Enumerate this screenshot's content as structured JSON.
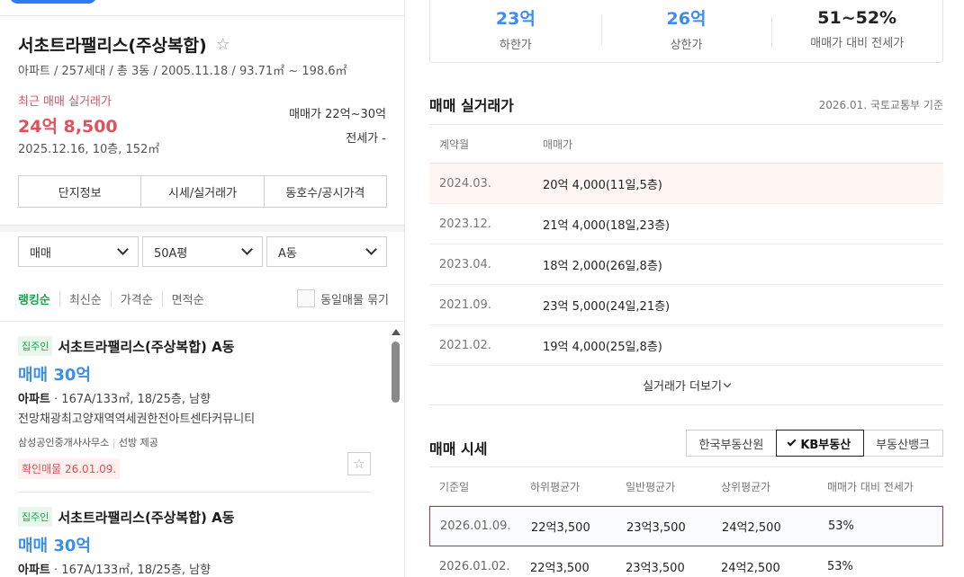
{
  "complex": {
    "title": "서초트라팰리스(주상복합)",
    "info": "아파트 / 257세대 / 총 3동 / 2005.11.18 / 93.71㎡ ~ 198.6㎡",
    "recent_label": "최근 매매 실거래가",
    "recent_price": "24억 8,500",
    "recent_detail": "2025.12.16, 10층, 152㎡",
    "sale_range_label": "매매가",
    "sale_range_value": "22억~30억",
    "lease_range_label": "전세가",
    "lease_range_value": "-",
    "tabs": [
      "단지정보",
      "시세/실거래가",
      "동호수/공시가격"
    ]
  },
  "filters": {
    "trade_type": "매매",
    "area": "50A평",
    "building": "A동"
  },
  "sort": {
    "items": [
      "랭킹순",
      "최신순",
      "가격순",
      "면적순"
    ],
    "same_listing_label": "동일매물 묶기"
  },
  "listings": [
    {
      "badge": "집주인",
      "title": "서초트라팰리스(주상복합) A동",
      "price": "매매 30억",
      "type": "아파트",
      "spec": "167A/133㎡, 18/25층, 남향",
      "desc": "전망채광최고양재역역세권한전아트센타커뮤니티",
      "agent": "삼성공인중개사사무소",
      "provider": "선방 제공",
      "confirm": "확인매물 26.01.09."
    },
    {
      "badge": "집주인",
      "title": "서초트라팰리스(주상복합) A동",
      "price": "매매 30억",
      "type": "아파트",
      "spec": "167A/133㎡, 18/25층, 남향"
    }
  ],
  "stats": [
    {
      "value": "23억",
      "label": "하한가"
    },
    {
      "value": "26억",
      "label": "상한가"
    },
    {
      "value": "51~52%",
      "label": "매매가 대비 전세가"
    }
  ],
  "transactions": {
    "title": "매매 실거래가",
    "note": "2026.01. 국토교통부 기준",
    "headers": [
      "계약월",
      "매매가"
    ],
    "rows": [
      {
        "month": "2024.03.",
        "price": "20억 4,000(11일,5층)"
      },
      {
        "month": "2023.12.",
        "price": "21억 4,000(18일,23층)"
      },
      {
        "month": "2023.04.",
        "price": "18억 2,000(26일,8층)"
      },
      {
        "month": "2021.09.",
        "price": "23억 5,000(24일,21층)"
      },
      {
        "month": "2021.02.",
        "price": "19억 4,000(25일,8층)"
      }
    ],
    "more": "실거래가 더보기"
  },
  "market": {
    "title": "매매 시세",
    "sources": [
      "한국부동산원",
      "KB부동산",
      "부동산뱅크"
    ],
    "headers": [
      "기준일",
      "하위평균가",
      "일반평균가",
      "상위평균가",
      "매매가 대비 전세가"
    ],
    "rows": [
      {
        "date": "2026.01.09.",
        "low": "22억3,500",
        "mid": "23억3,500",
        "high": "24억2,500",
        "ratio": "53%"
      },
      {
        "date": "2026.01.02.",
        "low": "22억3,500",
        "mid": "23억3,500",
        "high": "24억2,500",
        "ratio": "53%"
      }
    ]
  },
  "colors": {
    "accent_blue": "#3b8ef0",
    "accent_red": "#e2505a",
    "accent_green": "#18a34a",
    "selection_red": "#d9232d"
  }
}
